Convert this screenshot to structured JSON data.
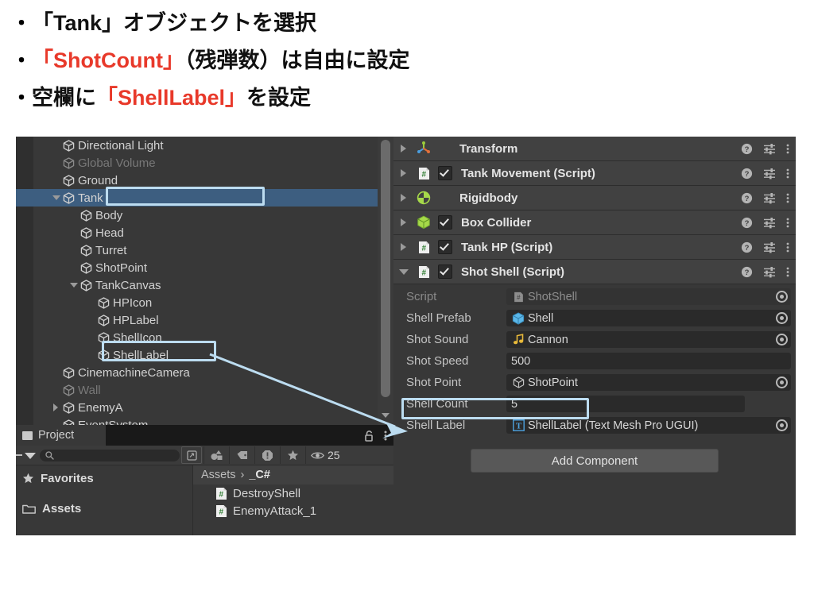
{
  "slide": {
    "bullets": [
      {
        "marker": "・",
        "segments": [
          {
            "text": "「Tank」オブジェクトを選択",
            "highlight": false
          }
        ]
      },
      {
        "marker": "・",
        "segments": [
          {
            "text": "「ShotCount」",
            "highlight": true
          },
          {
            "text": "（残弾数）は自由に設定",
            "highlight": false
          }
        ]
      },
      {
        "marker": "・",
        "segments": [
          {
            "text": "空欄に",
            "highlight": false
          },
          {
            "text": "「ShellLabel」",
            "highlight": true
          },
          {
            "text": "を設定",
            "highlight": false
          }
        ]
      }
    ],
    "highlight_color": "#e8392a",
    "annotation_color": "#bcdcf0"
  },
  "hierarchy": {
    "items": [
      {
        "label": "Directional Light",
        "indent": 1,
        "foldout": "none",
        "dim": false,
        "selected": false
      },
      {
        "label": "Global Volume",
        "indent": 1,
        "foldout": "none",
        "dim": true,
        "selected": false
      },
      {
        "label": "Ground",
        "indent": 1,
        "foldout": "none",
        "dim": false,
        "selected": false
      },
      {
        "label": "Tank",
        "indent": 1,
        "foldout": "open",
        "dim": false,
        "selected": true
      },
      {
        "label": "Body",
        "indent": 2,
        "foldout": "none",
        "dim": false,
        "selected": false
      },
      {
        "label": "Head",
        "indent": 2,
        "foldout": "none",
        "dim": false,
        "selected": false
      },
      {
        "label": "Turret",
        "indent": 2,
        "foldout": "none",
        "dim": false,
        "selected": false
      },
      {
        "label": "ShotPoint",
        "indent": 2,
        "foldout": "none",
        "dim": false,
        "selected": false
      },
      {
        "label": "TankCanvas",
        "indent": 2,
        "foldout": "open",
        "dim": false,
        "selected": false
      },
      {
        "label": "HPIcon",
        "indent": 3,
        "foldout": "none",
        "dim": false,
        "selected": false
      },
      {
        "label": "HPLabel",
        "indent": 3,
        "foldout": "none",
        "dim": false,
        "selected": false
      },
      {
        "label": "ShellIcon",
        "indent": 3,
        "foldout": "none",
        "dim": false,
        "selected": false
      },
      {
        "label": "ShellLabel",
        "indent": 3,
        "foldout": "none",
        "dim": false,
        "selected": false
      },
      {
        "label": "CinemachineCamera",
        "indent": 1,
        "foldout": "none",
        "dim": false,
        "selected": false
      },
      {
        "label": "Wall",
        "indent": 1,
        "foldout": "none",
        "dim": true,
        "selected": false
      },
      {
        "label": "EnemyA",
        "indent": 1,
        "foldout": "closed",
        "dim": false,
        "selected": false
      },
      {
        "label": "EventSystem",
        "indent": 1,
        "foldout": "none",
        "dim": false,
        "selected": false
      }
    ]
  },
  "inspector": {
    "components": [
      {
        "title": "Transform",
        "icon": "transform-gizmo-icon",
        "foldout": "closed",
        "checkbox": "none"
      },
      {
        "title": "Tank Movement (Script)",
        "icon": "script-icon",
        "foldout": "closed",
        "checkbox": "checked"
      },
      {
        "title": "Rigidbody",
        "icon": "rigidbody-icon",
        "foldout": "closed",
        "checkbox": "none"
      },
      {
        "title": "Box Collider",
        "icon": "box-collider-icon",
        "foldout": "closed",
        "checkbox": "checked"
      },
      {
        "title": "Tank HP (Script)",
        "icon": "script-icon",
        "foldout": "closed",
        "checkbox": "checked"
      },
      {
        "title": "Shot Shell (Script)",
        "icon": "script-icon",
        "foldout": "open",
        "checkbox": "checked"
      }
    ],
    "properties": [
      {
        "label": "Script",
        "value": "ShotShell",
        "icon": "script-gray-icon",
        "disabled": true,
        "picker": true,
        "narrow": false
      },
      {
        "label": "Shell Prefab",
        "value": "Shell",
        "icon": "prefab-cube-icon",
        "disabled": false,
        "picker": true,
        "narrow": false
      },
      {
        "label": "Shot Sound",
        "value": "Cannon",
        "icon": "audio-clip-icon",
        "disabled": false,
        "picker": true,
        "narrow": false
      },
      {
        "label": "Shot Speed",
        "value": "500",
        "icon": "none",
        "disabled": false,
        "picker": false,
        "narrow": false
      },
      {
        "label": "Shot Point",
        "value": "ShotPoint",
        "icon": "gameobject-cube-icon",
        "disabled": false,
        "picker": true,
        "narrow": false
      },
      {
        "label": "Shell Count",
        "value": "5",
        "icon": "none",
        "disabled": false,
        "picker": false,
        "narrow": true
      },
      {
        "label": "Shell Label",
        "value": "ShellLabel (Text Mesh Pro UGUI)",
        "icon": "textmeshpro-icon",
        "disabled": false,
        "picker": true,
        "narrow": false
      }
    ],
    "add_component_label": "Add Component",
    "row_actions": {
      "help": "help-icon",
      "preset": "preset-icon",
      "menu": "kebab-menu-icon"
    }
  },
  "project": {
    "tab_label": "Project",
    "search_value": "",
    "visible_count": "25",
    "left_items": [
      {
        "label": "Favorites",
        "icon": "star-icon"
      },
      {
        "label": "Assets",
        "icon": "folder-icon"
      }
    ],
    "breadcrumb": {
      "root": "Assets",
      "separator": "›",
      "current": "_C#"
    },
    "assets": [
      {
        "label": "DestroyShell",
        "icon": "script-icon"
      },
      {
        "label": "EnemyAttack_1",
        "icon": "script-icon"
      }
    ],
    "toolbar_icons": [
      "search-save-icon",
      "shape-filter-icon",
      "label-tag-icon",
      "warning-icon",
      "star-icon",
      "eye-icon"
    ],
    "tabbar_icons": [
      "lock-icon",
      "kebab-menu-icon"
    ]
  }
}
